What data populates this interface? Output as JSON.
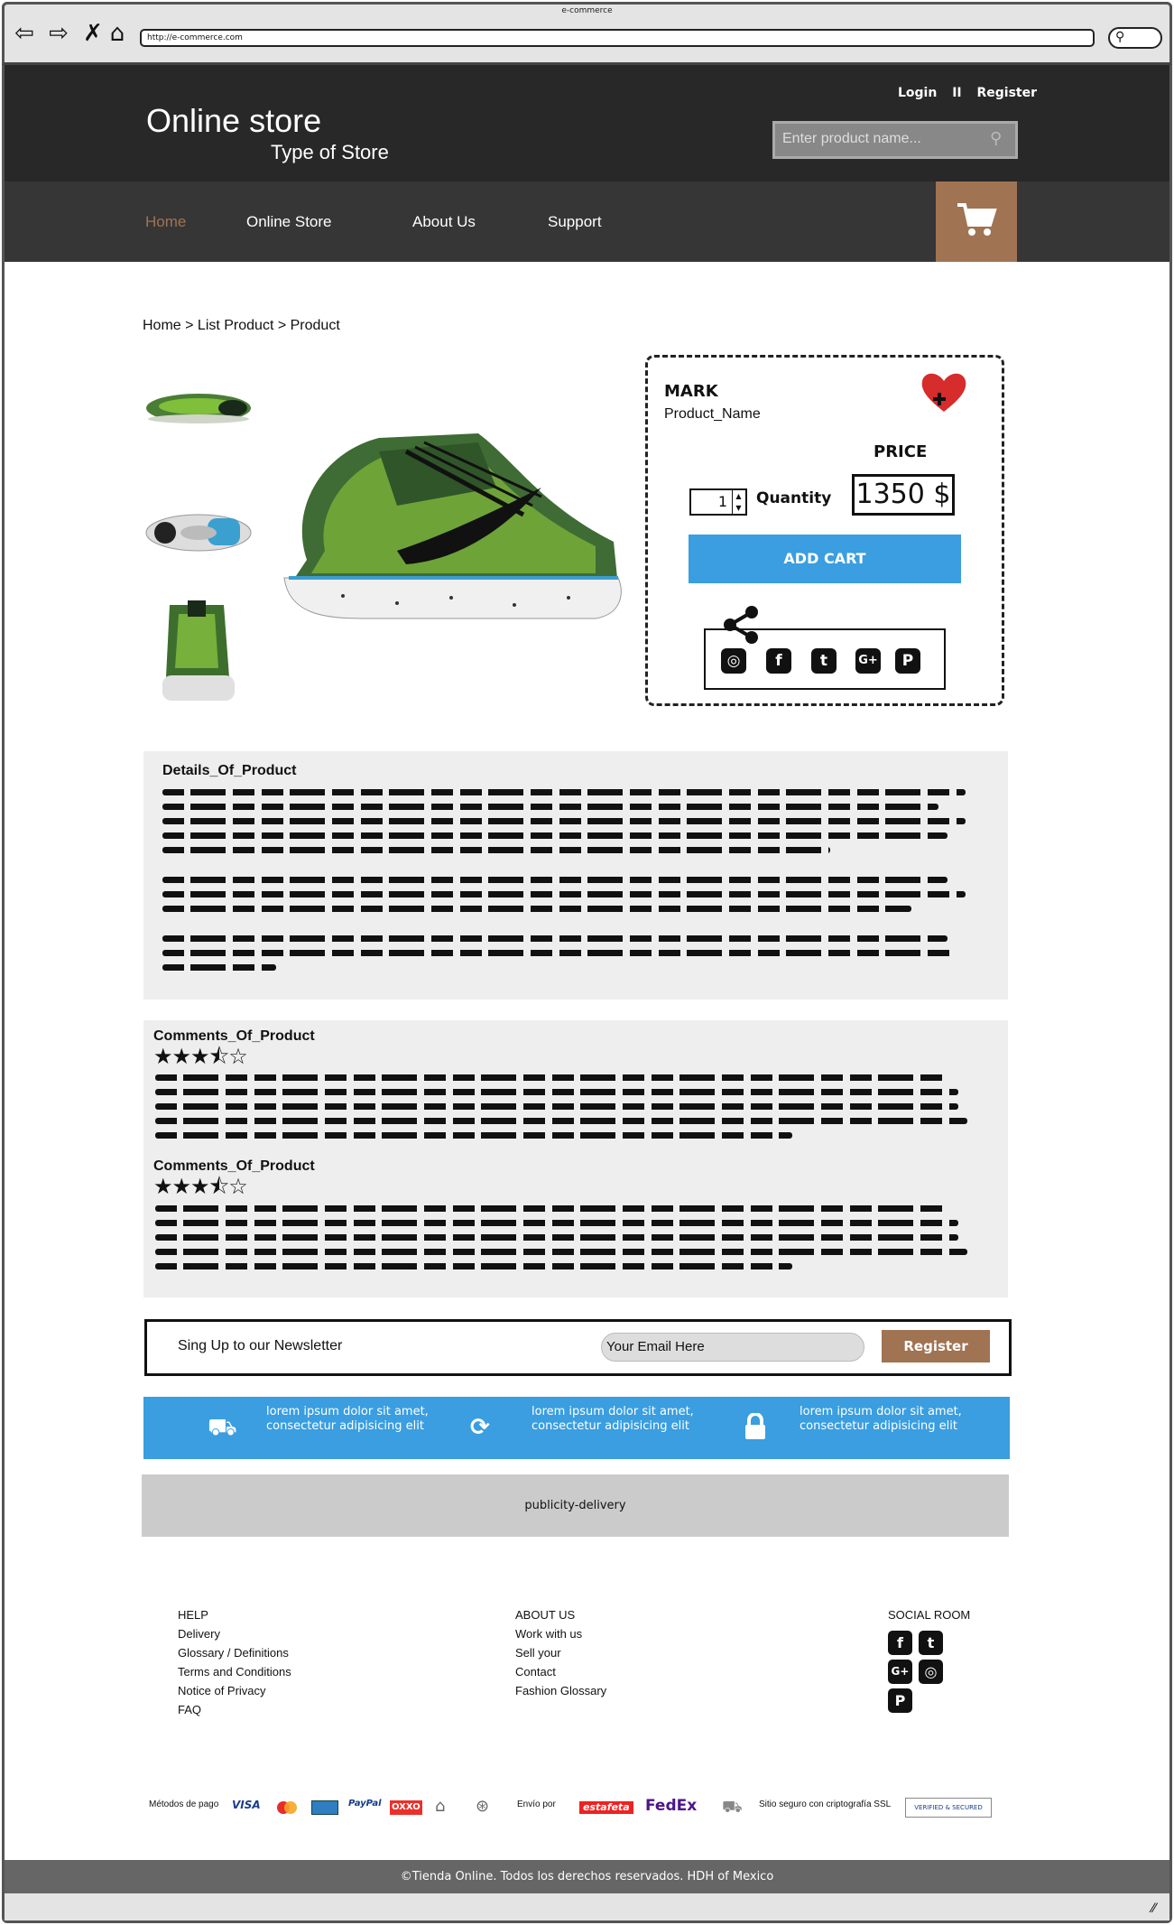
{
  "browser": {
    "window_title": "e-commerce",
    "url": "http://e-commerce.com"
  },
  "header": {
    "logo": "Online store",
    "subtitle": "Type of Store",
    "login": "Login",
    "separator": "II",
    "register": "Register",
    "search_placeholder": "Enter product name..."
  },
  "nav": {
    "items": [
      "Home",
      "Online Store",
      "About Us",
      "Support"
    ]
  },
  "breadcrumb": "Home > List Product > Product",
  "product": {
    "mark": "MARK",
    "name": "Product_Name",
    "price_label": "PRICE",
    "price": "1350 $",
    "quantity_value": "1",
    "quantity_label": "Quantity",
    "add_cart": "ADD CART"
  },
  "details": {
    "title": "Details_Of_Product"
  },
  "comments": [
    {
      "title": "Comments_Of_Product",
      "rating": "3.5"
    },
    {
      "title": "Comments_Of_Product",
      "rating": "3.5"
    }
  ],
  "newsletter": {
    "label": "Sing Up to our Newsletter",
    "email_placeholder": "Your Email Here",
    "button": "Register"
  },
  "features": [
    {
      "icon": "truck-icon",
      "text": "lorem ipsum dolor sit amet, consectetur adipisicing elit"
    },
    {
      "icon": "refresh-icon",
      "text": "lorem ipsum dolor sit amet, consectetur adipisicing elit"
    },
    {
      "icon": "lock-icon",
      "text": "lorem ipsum dolor sit amet, consectetur adipisicing elit"
    }
  ],
  "publicity": "publicity-delivery",
  "footer": {
    "help": {
      "title": "HELP",
      "items": [
        "Delivery",
        "Glossary / Definitions",
        "Terms and Conditions",
        "Notice of Privacy",
        "FAQ"
      ]
    },
    "about": {
      "title": "ABOUT US",
      "items": [
        "Work with us",
        "Sell your",
        "Contact",
        "Fashion Glossary"
      ]
    },
    "social_title": "SOCIAL ROOM"
  },
  "payments": {
    "label": "Métodos de pago",
    "logos": [
      "VISA",
      "PayPal",
      "OXXO"
    ],
    "delivery_label": "Envío por",
    "carriers": [
      "estafeta",
      "FedEx"
    ],
    "ssl_label": "Sitio seguro con criptografía SSL",
    "ssl_badge": "VERIFIED & SECURED"
  },
  "copyright": "©Tienda Online. Todos los derechos reservados. HDH of Mexico"
}
